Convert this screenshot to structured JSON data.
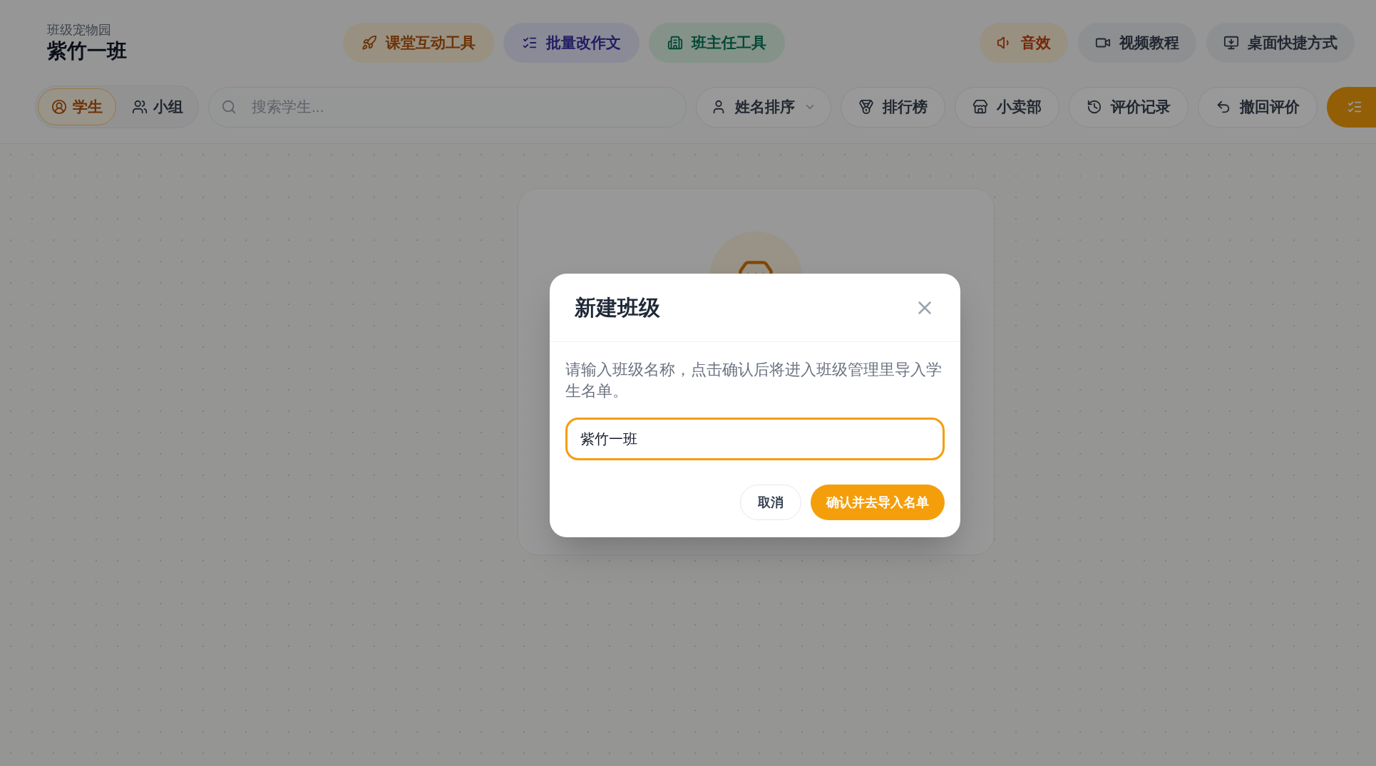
{
  "header": {
    "subtitle": "班级宠物园",
    "title": "紫竹一班"
  },
  "tool_buttons": [
    {
      "label": "课堂互动工具"
    },
    {
      "label": "批量改作文"
    },
    {
      "label": "班主任工具"
    }
  ],
  "utility_buttons": [
    {
      "label": "音效"
    },
    {
      "label": "视频教程"
    },
    {
      "label": "桌面快捷方式"
    }
  ],
  "view_toggle": [
    {
      "label": "学生",
      "selected": true
    },
    {
      "label": "小组",
      "selected": false
    }
  ],
  "search": {
    "placeholder": "搜索学生..."
  },
  "sort_dropdown": {
    "label": "姓名排序"
  },
  "actions": [
    {
      "label": "排行榜"
    },
    {
      "label": "小卖部"
    },
    {
      "label": "评价记录"
    },
    {
      "label": "撤回评价"
    }
  ],
  "dialog": {
    "title": "新建班级",
    "description": "请输入班级名称，点击确认后将进入班级管理里导入学生名单。",
    "input_value": "紫竹一班",
    "buttons": [
      {
        "label": "取消",
        "kind": "secondary"
      },
      {
        "label": "确认并去导入名单",
        "kind": "primary"
      }
    ]
  }
}
